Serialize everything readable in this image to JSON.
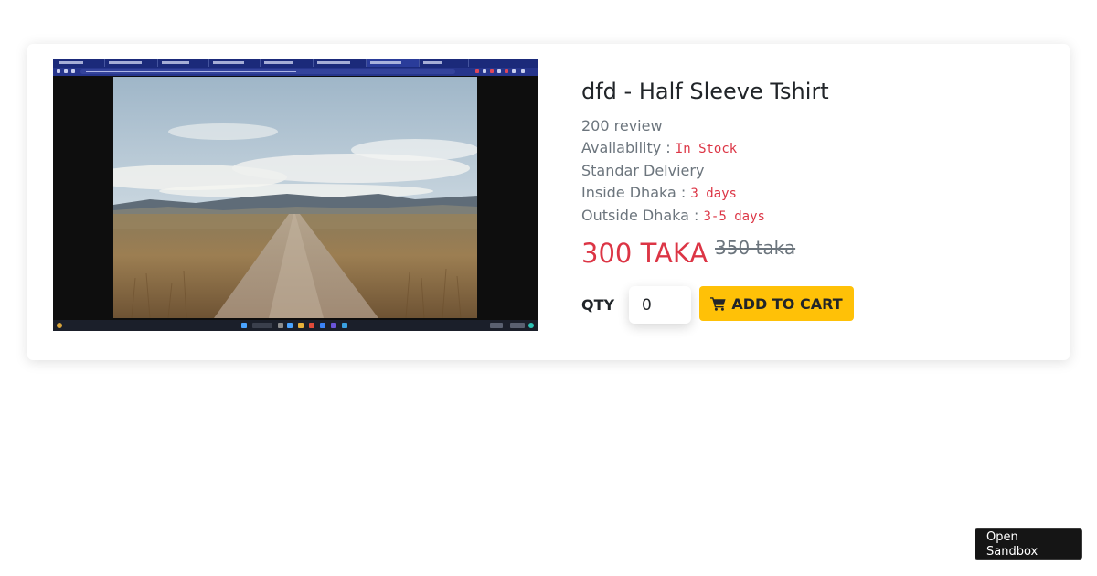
{
  "product": {
    "title": "dfd - Half Sleeve Tshirt",
    "reviews": "200 review",
    "availability_label": "Availability :",
    "availability_value": "In Stock",
    "delivery_heading": "Standar Delviery",
    "inside_label": "Inside Dhaka :",
    "inside_value": "3 days",
    "outside_label": "Outside Dhaka :",
    "outside_value": "3-5 days",
    "price": "300 TAKA",
    "old_price": "350 taka",
    "image_alt": "Product image showing a desktop screenshot of a dirt road through dry grassland",
    "image_icon": "product-photo"
  },
  "purchase": {
    "qty_label": "QTY",
    "qty_value": "0",
    "add_to_cart_label": "ADD TO CART",
    "cart_icon": "shopping-cart-icon"
  },
  "sandbox": {
    "label": "Open Sandbox"
  },
  "colors": {
    "price": "#dc3545",
    "muted": "#6c757d",
    "button": "#ffc107",
    "text": "#212529",
    "sandbox_bg": "#151515"
  }
}
